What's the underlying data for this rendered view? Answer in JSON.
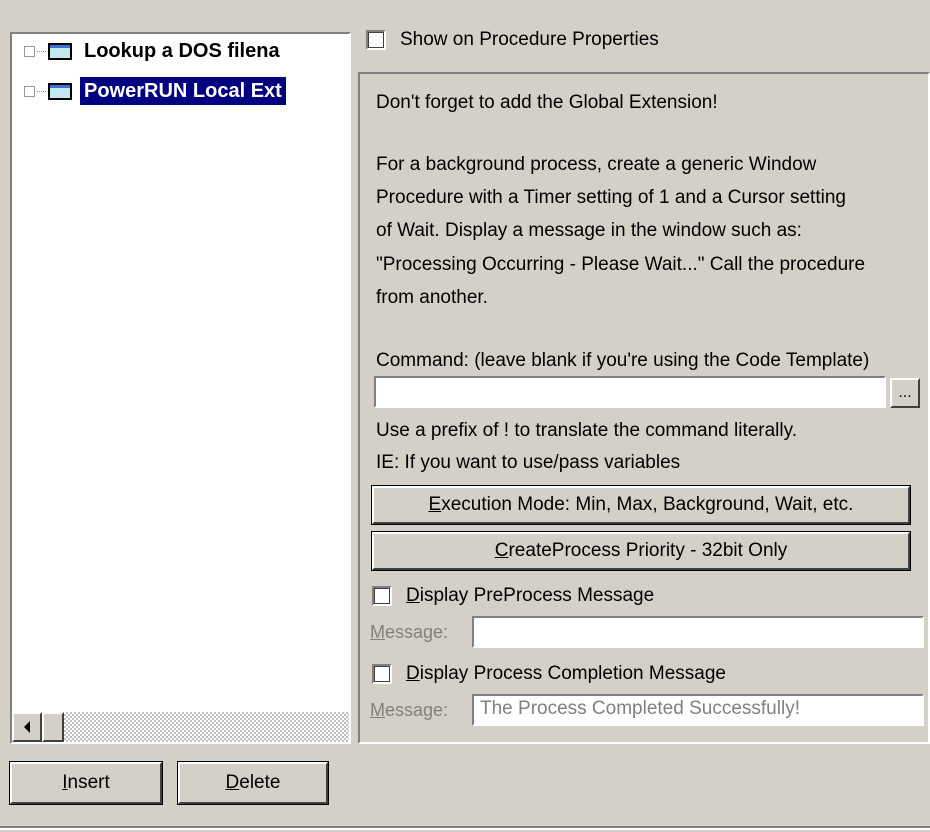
{
  "tree": {
    "items": [
      {
        "label": "Lookup a DOS filena",
        "selected": false
      },
      {
        "label": "PowerRUN Local Ext",
        "selected": true
      }
    ],
    "scroll_left_icon": "arrow-left-icon"
  },
  "buttons": {
    "insert_prefix": "",
    "insert_accel": "I",
    "insert_rest": "nsert",
    "delete_accel": "D",
    "delete_rest": "elete"
  },
  "show_on_props": {
    "label": "Show on Procedure Properties",
    "checked": false
  },
  "info": {
    "line1": "Don't forget to add the Global Extension!",
    "para": [
      "For a background process, create a generic Window",
      "Procedure with a Timer setting of 1 and a Cursor setting",
      "of Wait.  Display a message in the window such as:",
      "\"Processing Occurring - Please Wait...\"  Call the procedure",
      "from another."
    ]
  },
  "command": {
    "label": "Command: (leave blank if you're using the Code Template)",
    "value": "",
    "browse_label": "...",
    "hint1": "Use a prefix of ! to translate the command literally.",
    "hint2": "IE: If you want to use/pass variables"
  },
  "exec_mode_button": {
    "accel": "E",
    "rest": "xecution Mode: Min, Max, Background, Wait, etc."
  },
  "priority_button": {
    "accel": "C",
    "rest": "reateProcess Priority - 32bit Only"
  },
  "preprocess": {
    "checkbox_accel": "D",
    "checkbox_rest": "isplay PreProcess Message",
    "checked": false,
    "message_accel": "M",
    "message_rest": "essage:",
    "message_value": ""
  },
  "completion": {
    "checkbox_accel": "D",
    "checkbox_rest": "isplay Process Completion Message",
    "checked": false,
    "message_accel": "M",
    "message_rest": "essage:",
    "message_value": "The Process Completed Successfully!"
  }
}
